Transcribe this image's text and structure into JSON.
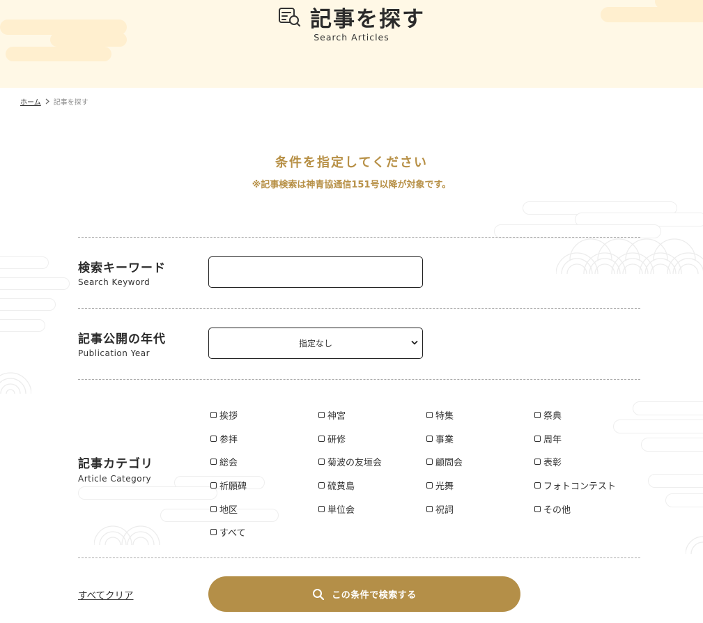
{
  "hero": {
    "title": "記事を探す",
    "subtitle": "Search Articles",
    "icon": "article-search-icon"
  },
  "breadcrumb": {
    "home": "ホーム",
    "current": "記事を探す"
  },
  "conditions": {
    "title": "条件を指定してください",
    "note": "※記事検索は神青協通信151号以降が対象です。"
  },
  "keyword": {
    "label_jp": "検索キーワード",
    "label_en": "Search Keyword",
    "value": "",
    "placeholder": ""
  },
  "year": {
    "label_jp": "記事公開の年代",
    "label_en": "Publication Year",
    "selected": "指定なし"
  },
  "category": {
    "label_jp": "記事カテゴリ",
    "label_en": "Article Category",
    "items": [
      "挨拶",
      "神宮",
      "特集",
      "祭典",
      "参拝",
      "研修",
      "事業",
      "周年",
      "総会",
      "菊波の友垣会",
      "顧問会",
      "表彰",
      "祈願碑",
      "硫黄島",
      "光舞",
      "フォトコンテスト",
      "地区",
      "単位会",
      "祝詞",
      "その他",
      "すべて"
    ]
  },
  "actions": {
    "clear": "すべてクリア",
    "search": "この条件で検索する"
  },
  "colors": {
    "accent": "#b79046",
    "button": "#b48f48",
    "hero_bg": "#fff8e6",
    "hero_cloud": "#ffefcf"
  }
}
